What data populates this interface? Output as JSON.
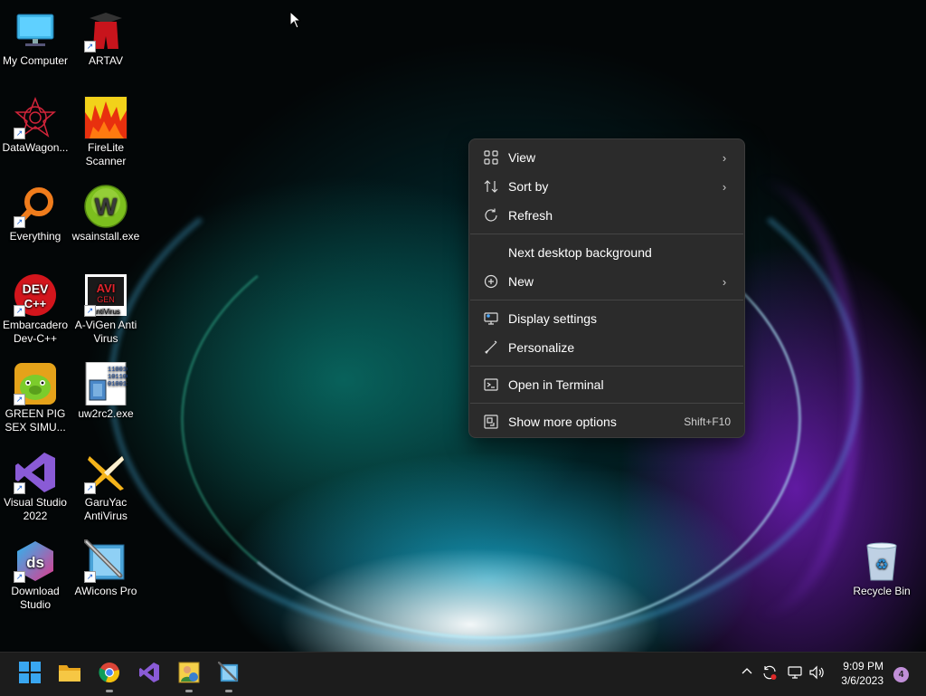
{
  "desktop": {
    "icons": [
      {
        "name": "my-computer",
        "label": "My Computer",
        "icon": "monitor-icon"
      },
      {
        "name": "artav",
        "label": "ARTAV",
        "icon": "artav-icon"
      },
      {
        "name": "datawagon",
        "label": "DataWagon...",
        "icon": "datawagon-icon"
      },
      {
        "name": "firelite-scanner",
        "label": "FireLite Scanner",
        "icon": "fire-icon"
      },
      {
        "name": "everything",
        "label": "Everything",
        "icon": "magnifier-icon"
      },
      {
        "name": "wsainstall",
        "label": "wsainstall.exe",
        "icon": "wsa-icon"
      },
      {
        "name": "embarcadero-devcpp",
        "label": "Embarcadero Dev-C++",
        "icon": "devcpp-icon"
      },
      {
        "name": "a-vigen",
        "label": "A-ViGen Anti Virus",
        "icon": "avigen-icon"
      },
      {
        "name": "green-pig",
        "label": "GREEN PIG SEX SIMU...",
        "icon": "pig-icon"
      },
      {
        "name": "uw2rc2",
        "label": "uw2rc2.exe",
        "icon": "binary-icon"
      },
      {
        "name": "visual-studio",
        "label": "Visual Studio 2022",
        "icon": "visual-studio-icon"
      },
      {
        "name": "garuyac",
        "label": "GaruYac AntiVirus",
        "icon": "garuyac-icon"
      },
      {
        "name": "download-studio",
        "label": "Download Studio",
        "icon": "ds-icon"
      },
      {
        "name": "awicons-pro",
        "label": "AWicons Pro",
        "icon": "awicons-icon"
      },
      {
        "name": "recycle-bin",
        "label": "Recycle Bin",
        "icon": "recycle-bin-icon"
      }
    ],
    "avigen_text": "AVI GEN",
    "devcpp_text": "DEV C++",
    "wsa_letter": "W",
    "ds_text": "ds",
    "binary_text": "110010 101100 010011"
  },
  "context_menu": {
    "items": {
      "view": {
        "label": "View",
        "icon": "grid-icon",
        "arrow": "›"
      },
      "sort_by": {
        "label": "Sort by",
        "icon": "sort-icon",
        "arrow": "›"
      },
      "refresh": {
        "label": "Refresh",
        "icon": "refresh-icon"
      },
      "next_bg": {
        "label": "Next desktop background"
      },
      "new": {
        "label": "New",
        "icon": "plus-circle-icon",
        "arrow": "›"
      },
      "display_settings": {
        "label": "Display settings",
        "icon": "display-settings-icon"
      },
      "personalize": {
        "label": "Personalize",
        "icon": "brush-icon"
      },
      "open_terminal": {
        "label": "Open in Terminal",
        "icon": "terminal-icon"
      },
      "show_more": {
        "label": "Show more options",
        "icon": "more-options-icon",
        "shortcut": "Shift+F10"
      }
    }
  },
  "taskbar": {
    "apps": [
      "start-icon",
      "file-explorer-icon",
      "chrome-icon",
      "visual-studio-icon",
      "app-icon",
      "awicons-icon"
    ],
    "tray": {
      "chevron": "^",
      "time": "9:09 PM",
      "date": "3/6/2023",
      "notifications": "4"
    }
  },
  "colors": {
    "menu_bg": "#2b2b2b",
    "taskbar_bg": "#1c1c1c",
    "accent": "#0078d4"
  }
}
